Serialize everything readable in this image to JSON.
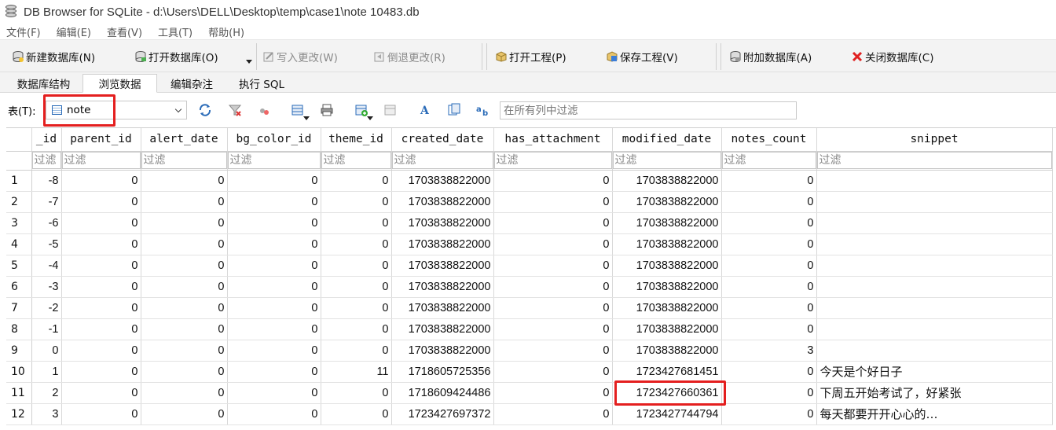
{
  "window": {
    "title": "DB Browser for SQLite - d:\\Users\\DELL\\Desktop\\temp\\case1\\note 10483.db"
  },
  "menu": [
    "文件(F)",
    "编辑(E)",
    "查看(V)",
    "工具(T)",
    "帮助(H)"
  ],
  "toolbar": {
    "new_db": "新建数据库(N)",
    "open_db": "打开数据库(O)",
    "write_changes": "写入更改(W)",
    "revert_changes": "倒退更改(R)",
    "open_project": "打开工程(P)",
    "save_project": "保存工程(V)",
    "attach_db": "附加数据库(A)",
    "close_db": "关闭数据库(C)"
  },
  "tabs": [
    "数据库结构",
    "浏览数据",
    "编辑杂注",
    "执行 SQL"
  ],
  "active_tab": "浏览数据",
  "table_selector": {
    "label": "表(T):",
    "value": "note"
  },
  "global_filter": {
    "placeholder": "在所有列中过滤"
  },
  "grid": {
    "columns": [
      "_id",
      "parent_id",
      "alert_date",
      "bg_color_id",
      "theme_id",
      "created_date",
      "has_attachment",
      "modified_date",
      "notes_count",
      "snippet"
    ],
    "filter_placeholder": "过滤",
    "rows": [
      [
        "1",
        "-8",
        "0",
        "0",
        "0",
        "0",
        "1703838822000",
        "0",
        "1703838822000",
        "0",
        ""
      ],
      [
        "2",
        "-7",
        "0",
        "0",
        "0",
        "0",
        "1703838822000",
        "0",
        "1703838822000",
        "0",
        ""
      ],
      [
        "3",
        "-6",
        "0",
        "0",
        "0",
        "0",
        "1703838822000",
        "0",
        "1703838822000",
        "0",
        ""
      ],
      [
        "4",
        "-5",
        "0",
        "0",
        "0",
        "0",
        "1703838822000",
        "0",
        "1703838822000",
        "0",
        ""
      ],
      [
        "5",
        "-4",
        "0",
        "0",
        "0",
        "0",
        "1703838822000",
        "0",
        "1703838822000",
        "0",
        ""
      ],
      [
        "6",
        "-3",
        "0",
        "0",
        "0",
        "0",
        "1703838822000",
        "0",
        "1703838822000",
        "0",
        ""
      ],
      [
        "7",
        "-2",
        "0",
        "0",
        "0",
        "0",
        "1703838822000",
        "0",
        "1703838822000",
        "0",
        ""
      ],
      [
        "8",
        "-1",
        "0",
        "0",
        "0",
        "0",
        "1703838822000",
        "0",
        "1703838822000",
        "0",
        ""
      ],
      [
        "9",
        "0",
        "0",
        "0",
        "0",
        "0",
        "1703838822000",
        "0",
        "1703838822000",
        "3",
        ""
      ],
      [
        "10",
        "1",
        "0",
        "0",
        "0",
        "11",
        "1718605725356",
        "0",
        "1723427681451",
        "0",
        "今天是个好日子"
      ],
      [
        "11",
        "2",
        "0",
        "0",
        "0",
        "0",
        "1718609424486",
        "0",
        "1723427660361",
        "0",
        "下周五开始考试了，好紧张"
      ],
      [
        "12",
        "3",
        "0",
        "0",
        "0",
        "0",
        "1723427697372",
        "0",
        "1723427744794",
        "0",
        "每天都要开开心心的…"
      ]
    ]
  },
  "colors": {
    "highlight": "#e41f1f",
    "toolbar_bg": "#f3f3f3"
  }
}
